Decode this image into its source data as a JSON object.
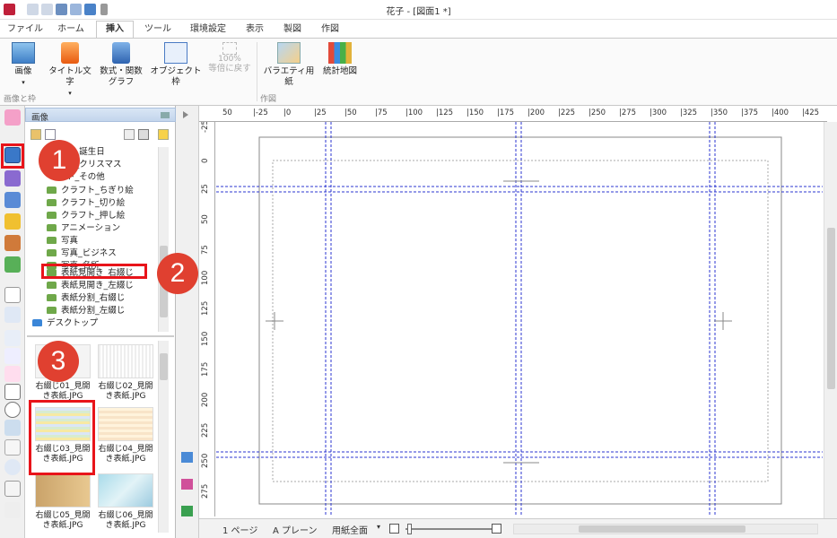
{
  "window": {
    "title": "花子 - [図面1 *]"
  },
  "tabs": [
    "ファイル",
    "ホーム",
    "挿入",
    "ツール",
    "環境設定",
    "表示",
    "製図",
    "作図"
  ],
  "ribbon": {
    "buttons": [
      "画像",
      "タイトル文字",
      "数式・関数\nグラフ",
      "オブジェクト枠",
      "等倍に戻す",
      "バラエティ用紙",
      "統計地図"
    ],
    "zoom_text": "100%",
    "groups": [
      "画像と枠",
      "作図"
    ]
  },
  "panel": {
    "title": "画像",
    "tree": [
      "ト_誕生日",
      "ト_クリスマス",
      "ト_その他",
      "クラフト_ちぎり絵",
      "クラフト_切り絵",
      "クラフト_押し絵",
      "アニメーション",
      "写真",
      "写真_ビジネス",
      "写真_名所",
      "表紙見開き_右綴じ",
      "表紙見開き_左綴じ",
      "表紙分割_右綴じ",
      "表紙分割_左綴じ",
      "デスクトップ"
    ],
    "thumbs": [
      "右綴じ01_見開き表紙.JPG",
      "右綴じ02_見開き表紙.JPG",
      "右綴じ03_見開き表紙.JPG",
      "右綴じ04_見開き表紙.JPG",
      "右綴じ05_見開き表紙.JPG",
      "右綴じ06_見開き表紙.JPG"
    ]
  },
  "annotations": [
    "1",
    "2",
    "3"
  ],
  "ruler": {
    "h": [
      "50",
      "|-25",
      "|0",
      "|25",
      "|50",
      "|75",
      "|100",
      "|125",
      "|150",
      "|175",
      "|200",
      "|225",
      "|250",
      "|275",
      "|300",
      "|325",
      "|350",
      "|375",
      "|400",
      "|425"
    ],
    "v": [
      "-25",
      "0",
      "25",
      "50",
      "75",
      "100",
      "125",
      "150",
      "175",
      "200",
      "225",
      "250",
      "275"
    ]
  },
  "status": {
    "page": "1 ページ",
    "plane": "A プレーン",
    "paper": "用紙全面"
  },
  "colors": {
    "accent": "#1e6fc7",
    "annotation": "#e04030",
    "guide": "#2b35d1"
  }
}
